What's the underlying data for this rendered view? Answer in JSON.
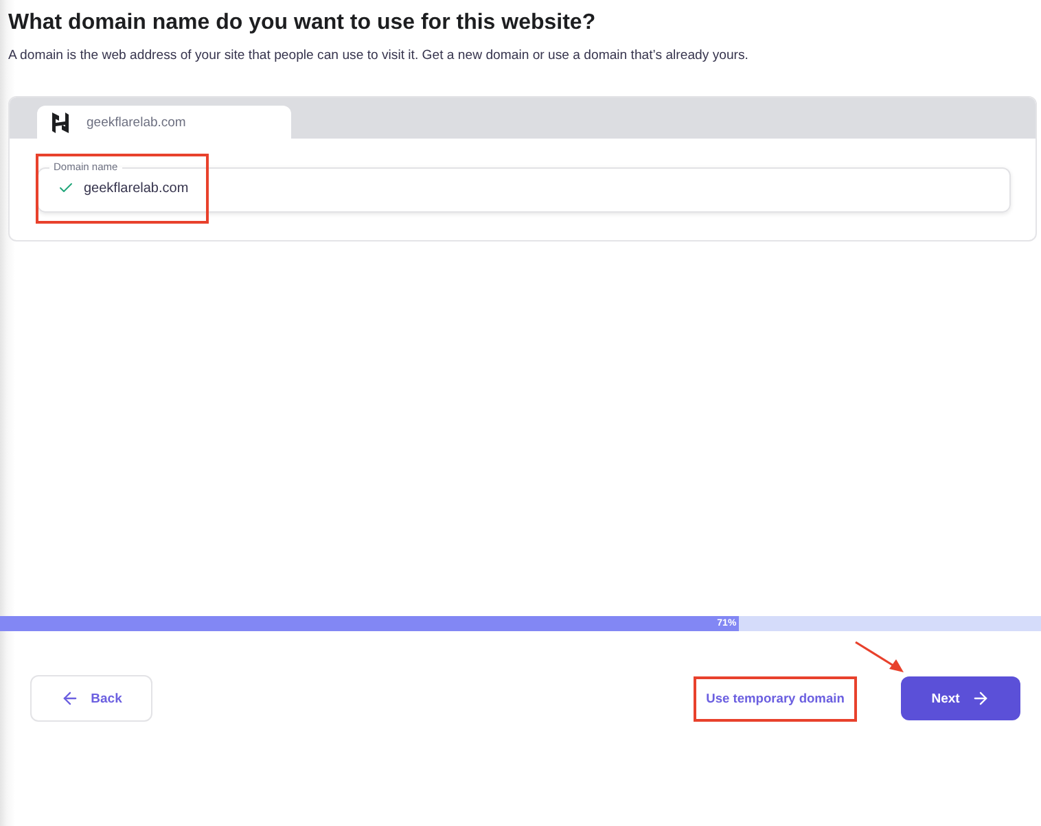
{
  "page": {
    "title": "What domain name do you want to use for this website?",
    "subtitle": "A domain is the web address of your site that people can use to visit it. Get a new domain or use a domain that’s already yours."
  },
  "domain_tabs": [
    {
      "label": "geekflarelab.com",
      "selected": true
    }
  ],
  "domain_field": {
    "label": "Domain name",
    "value": "geekflarelab.com",
    "valid": true
  },
  "progress": {
    "level": 0.71,
    "reading": "71%"
  },
  "actions": {
    "back": "Back",
    "temporary": "Use temporary domain",
    "next": "Next"
  }
}
